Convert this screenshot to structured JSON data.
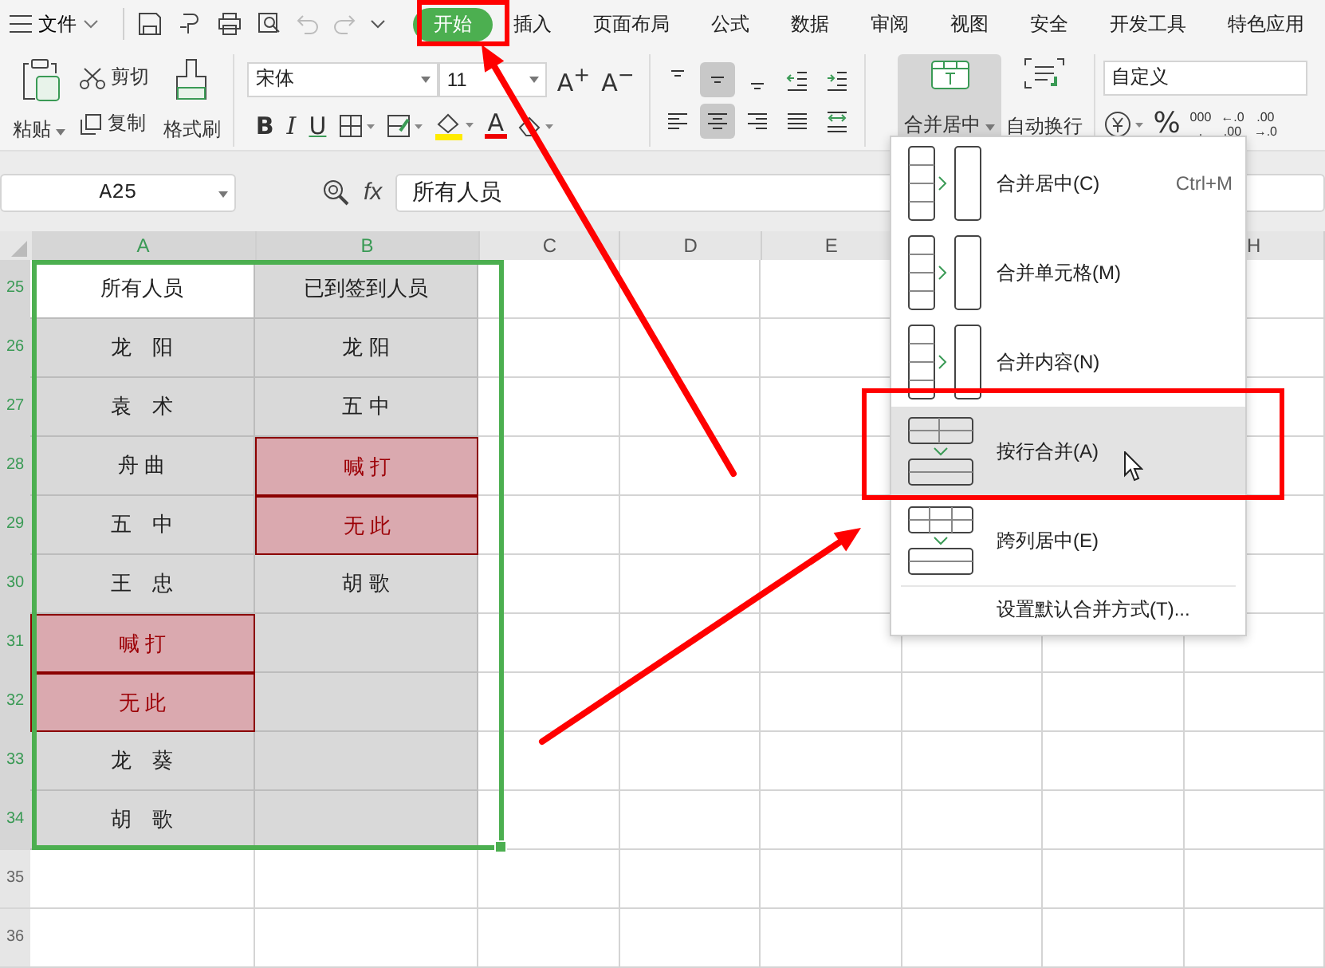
{
  "menu_bar": {
    "file_label": "文件",
    "tabs": [
      {
        "label": "开始",
        "selected": true
      },
      {
        "label": "插入",
        "selected": false
      },
      {
        "label": "页面布局",
        "selected": false
      },
      {
        "label": "公式",
        "selected": false
      },
      {
        "label": "数据",
        "selected": false
      },
      {
        "label": "审阅",
        "selected": false
      },
      {
        "label": "视图",
        "selected": false
      },
      {
        "label": "安全",
        "selected": false
      },
      {
        "label": "开发工具",
        "selected": false
      },
      {
        "label": "特色应用",
        "selected": false
      }
    ]
  },
  "ribbon": {
    "clipboard": {
      "paste": "粘贴",
      "cut": "剪切",
      "copy": "复制",
      "format_painter": "格式刷"
    },
    "font": {
      "name": "宋体",
      "size": "11",
      "grow": "A$^{+}$",
      "shrink": "A$^{−}$",
      "bold": "B",
      "italic": "I",
      "underline": "U",
      "font_color": "A"
    },
    "alignment": [
      {
        "kind": "top",
        "selected": false
      },
      {
        "kind": "middle",
        "selected": true
      },
      {
        "kind": "bottom",
        "selected": false
      },
      {
        "kind": "indent-less",
        "selected": false
      },
      {
        "kind": "indent-more",
        "selected": false
      },
      {
        "kind": "left",
        "selected": false
      },
      {
        "kind": "center",
        "selected": true
      },
      {
        "kind": "right",
        "selected": false
      },
      {
        "kind": "justify",
        "selected": false
      },
      {
        "kind": "distributed",
        "selected": false
      }
    ],
    "merge_button": {
      "label": "合并居中",
      "expanded": true
    },
    "wrap_button": {
      "label": "自动换行"
    },
    "number": {
      "format": "自定义",
      "percent": "%",
      "thousands": [
        "000",
        ","
      ],
      "increase_decimal": [
        "←.0",
        ".00"
      ],
      "decrease_decimal": [
        ".00",
        "→.0"
      ]
    }
  },
  "formula_bar": {
    "name_box": "A25",
    "fx": "fx",
    "value": "所有人员"
  },
  "sheet": {
    "columns": [
      {
        "label": "A",
        "selected": true
      },
      {
        "label": "B",
        "selected": true
      },
      {
        "label": "C",
        "selected": false
      },
      {
        "label": "D",
        "selected": false
      },
      {
        "label": "E",
        "selected": false
      },
      {
        "label": "H",
        "selected": false
      }
    ],
    "rows": [
      {
        "number": "25",
        "selected": true,
        "cells": [
          {
            "text": "所有人员",
            "active": true,
            "highlighted": false
          },
          {
            "text": "已到签到人员",
            "active": false,
            "highlighted": false
          }
        ]
      },
      {
        "number": "26",
        "selected": true,
        "cells": [
          {
            "text": "龙　阳",
            "active": false,
            "highlighted": false
          },
          {
            "text": "龙 阳",
            "active": false,
            "highlighted": false
          }
        ]
      },
      {
        "number": "27",
        "selected": true,
        "cells": [
          {
            "text": "袁　术",
            "active": false,
            "highlighted": false
          },
          {
            "text": "五 中",
            "active": false,
            "highlighted": false
          }
        ]
      },
      {
        "number": "28",
        "selected": true,
        "cells": [
          {
            "text": "舟 曲",
            "active": false,
            "highlighted": false
          },
          {
            "text": "喊 打",
            "active": false,
            "highlighted": true
          }
        ]
      },
      {
        "number": "29",
        "selected": true,
        "cells": [
          {
            "text": "五　中",
            "active": false,
            "highlighted": false
          },
          {
            "text": "无 此",
            "active": false,
            "highlighted": true
          }
        ]
      },
      {
        "number": "30",
        "selected": true,
        "cells": [
          {
            "text": "王　忠",
            "active": false,
            "highlighted": false
          },
          {
            "text": "胡 歌",
            "active": false,
            "highlighted": false
          }
        ]
      },
      {
        "number": "31",
        "selected": true,
        "cells": [
          {
            "text": "喊 打",
            "active": false,
            "highlighted": true
          },
          {
            "active": false,
            "highlighted": false
          }
        ]
      },
      {
        "number": "32",
        "selected": true,
        "cells": [
          {
            "text": "无 此",
            "active": false,
            "highlighted": true
          },
          {
            "active": false,
            "highlighted": false
          }
        ]
      },
      {
        "number": "33",
        "selected": true,
        "cells": [
          {
            "text": "龙　葵",
            "active": false,
            "highlighted": false
          },
          {
            "active": false,
            "highlighted": false
          }
        ]
      },
      {
        "number": "34",
        "selected": true,
        "cells": [
          {
            "text": "胡　歌",
            "active": false,
            "highlighted": false
          },
          {
            "active": false,
            "highlighted": false
          }
        ]
      },
      {
        "number": "35",
        "selected": false,
        "cells": [
          {
            "active": false,
            "highlighted": false
          },
          {
            "active": false,
            "highlighted": false
          }
        ]
      },
      {
        "number": "36",
        "selected": false,
        "cells": [
          {
            "active": false,
            "highlighted": false
          },
          {
            "active": false,
            "highlighted": false
          }
        ]
      }
    ]
  },
  "merge_menu": {
    "items": [
      {
        "kind": "merge-center",
        "label": "合并居中(C)",
        "shortcut": "Ctrl+M",
        "selected": false
      },
      {
        "kind": "merge-cells",
        "label": "合并单元格(M)",
        "selected": false
      },
      {
        "kind": "merge-content",
        "label": "合并内容(N)",
        "selected": false
      },
      {
        "kind": "merge-rows",
        "label": "按行合并(A)",
        "selected": true
      },
      {
        "kind": "center-across",
        "label": "跨列居中(E)",
        "selected": false
      },
      {
        "kind": "setting",
        "label": "设置默认合并方式(T)...",
        "selected": false
      }
    ]
  }
}
